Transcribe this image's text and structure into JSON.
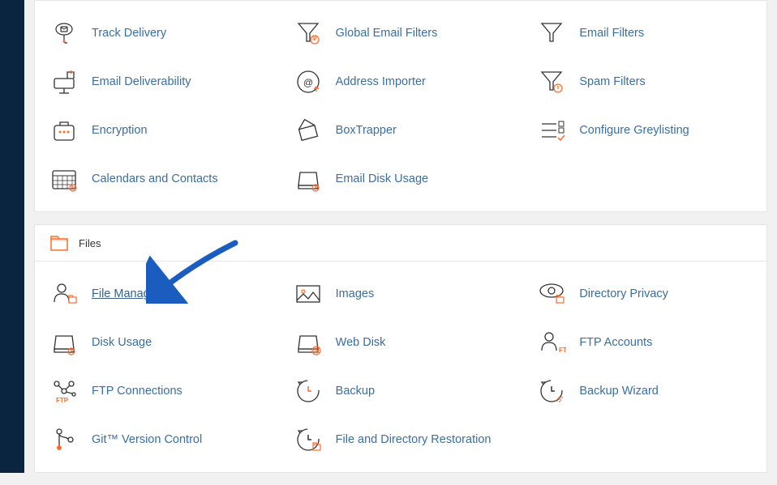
{
  "email_section": {
    "items": [
      {
        "label": "Track Delivery",
        "icon": "track-delivery-icon"
      },
      {
        "label": "Global Email Filters",
        "icon": "global-filters-icon"
      },
      {
        "label": "Email Filters",
        "icon": "email-filters-icon"
      },
      {
        "label": "Email Deliverability",
        "icon": "deliverability-icon"
      },
      {
        "label": "Address Importer",
        "icon": "address-importer-icon"
      },
      {
        "label": "Spam Filters",
        "icon": "spam-filters-icon"
      },
      {
        "label": "Encryption",
        "icon": "encryption-icon"
      },
      {
        "label": "BoxTrapper",
        "icon": "boxtrapper-icon"
      },
      {
        "label": "Configure Greylisting",
        "icon": "greylisting-icon"
      },
      {
        "label": "Calendars and Contacts",
        "icon": "calendars-icon"
      },
      {
        "label": "Email Disk Usage",
        "icon": "email-disk-usage-icon"
      }
    ]
  },
  "files_section": {
    "title": "Files",
    "items": [
      {
        "label": "File Manager",
        "icon": "file-manager-icon",
        "highlight": true
      },
      {
        "label": "Images",
        "icon": "images-icon"
      },
      {
        "label": "Directory Privacy",
        "icon": "directory-privacy-icon"
      },
      {
        "label": "Disk Usage",
        "icon": "disk-usage-icon"
      },
      {
        "label": "Web Disk",
        "icon": "web-disk-icon"
      },
      {
        "label": "FTP Accounts",
        "icon": "ftp-accounts-icon"
      },
      {
        "label": "FTP Connections",
        "icon": "ftp-connections-icon"
      },
      {
        "label": "Backup",
        "icon": "backup-icon"
      },
      {
        "label": "Backup Wizard",
        "icon": "backup-wizard-icon"
      },
      {
        "label": "Git™ Version Control",
        "icon": "git-icon"
      },
      {
        "label": "File and Directory Restoration",
        "icon": "restoration-icon"
      }
    ]
  },
  "colors": {
    "link": "#3a6ea5",
    "accent": "#ff6c2c",
    "arrow": "#1a5dbf"
  }
}
